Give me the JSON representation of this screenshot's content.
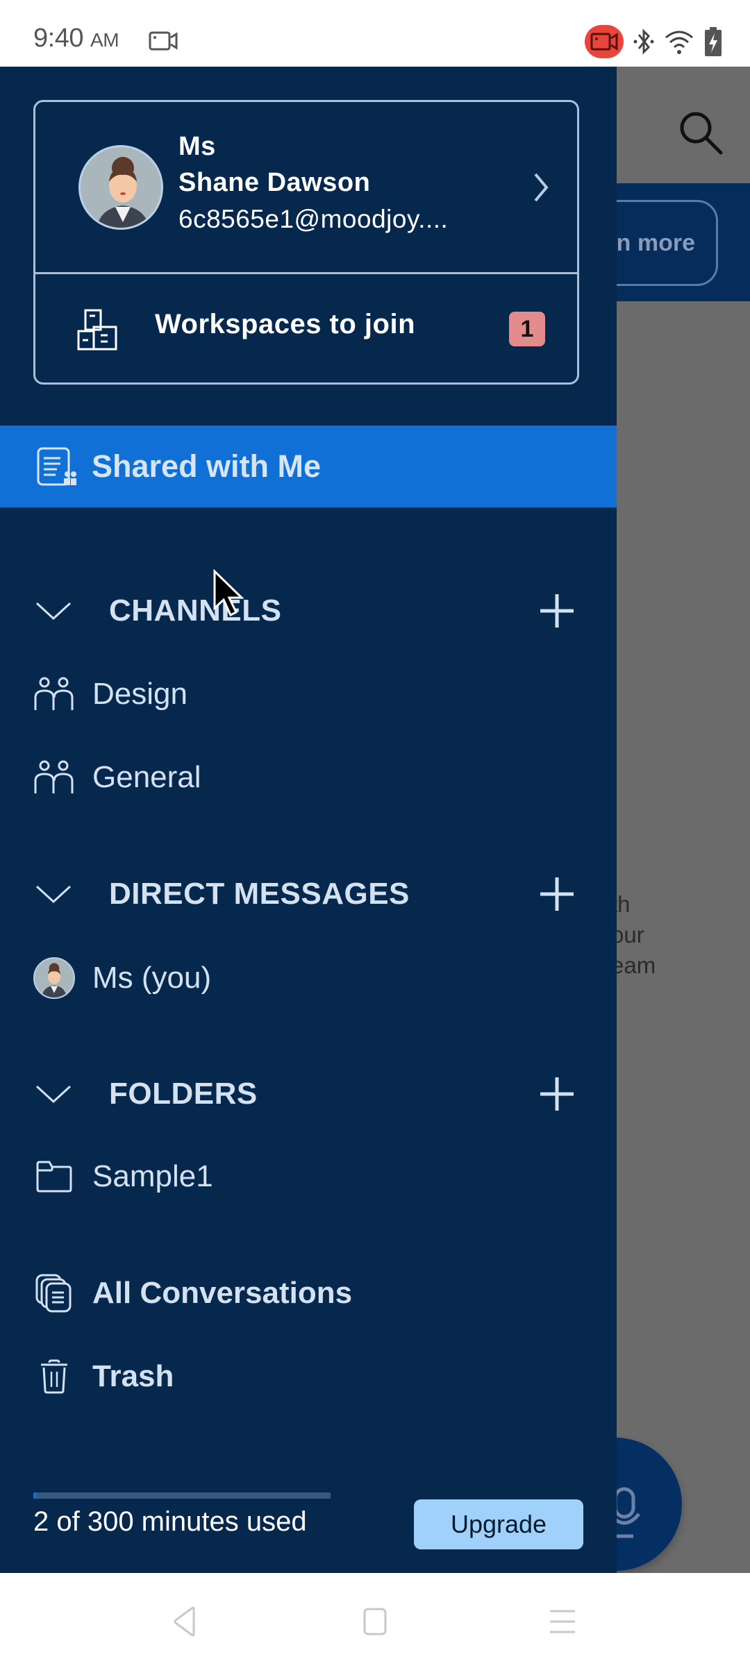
{
  "status_bar": {
    "time": "9:40",
    "ampm": "AM",
    "icons": [
      "screen-record-icon",
      "camera-recording-icon",
      "bluetooth-icon",
      "wifi-icon",
      "battery-charging-icon"
    ],
    "record_color": "#e8453c"
  },
  "background_app": {
    "learn_more_label": "n more",
    "body_text_lines": [
      "th",
      "our",
      "eam"
    ],
    "icons": [
      "search-icon",
      "microphone-icon"
    ]
  },
  "profile": {
    "title": "Ms",
    "name": "Shane Dawson",
    "email": "6c8565e1@moodjoy....",
    "workspaces_label": "Workspaces to join",
    "workspaces_badge": "1"
  },
  "shared": {
    "label": "Shared with Me"
  },
  "sections": {
    "channels": {
      "title": "CHANNELS",
      "items": [
        {
          "label": "Design"
        },
        {
          "label": "General"
        }
      ]
    },
    "direct_messages": {
      "title": "DIRECT MESSAGES",
      "items": [
        {
          "label": "Ms (you)"
        }
      ]
    },
    "folders": {
      "title": "FOLDERS",
      "items": [
        {
          "label": "Sample1"
        }
      ]
    }
  },
  "extra_items": {
    "all_conversations": "All Conversations",
    "trash": "Trash"
  },
  "usage": {
    "text": "2 of 300 minutes used",
    "used": 2,
    "total": 300,
    "upgrade_label": "Upgrade"
  },
  "colors": {
    "drawer_bg": "#06284d",
    "accent": "#1170d6",
    "badge": "#e48c8d",
    "upgrade_bg": "#9fd1fa"
  }
}
